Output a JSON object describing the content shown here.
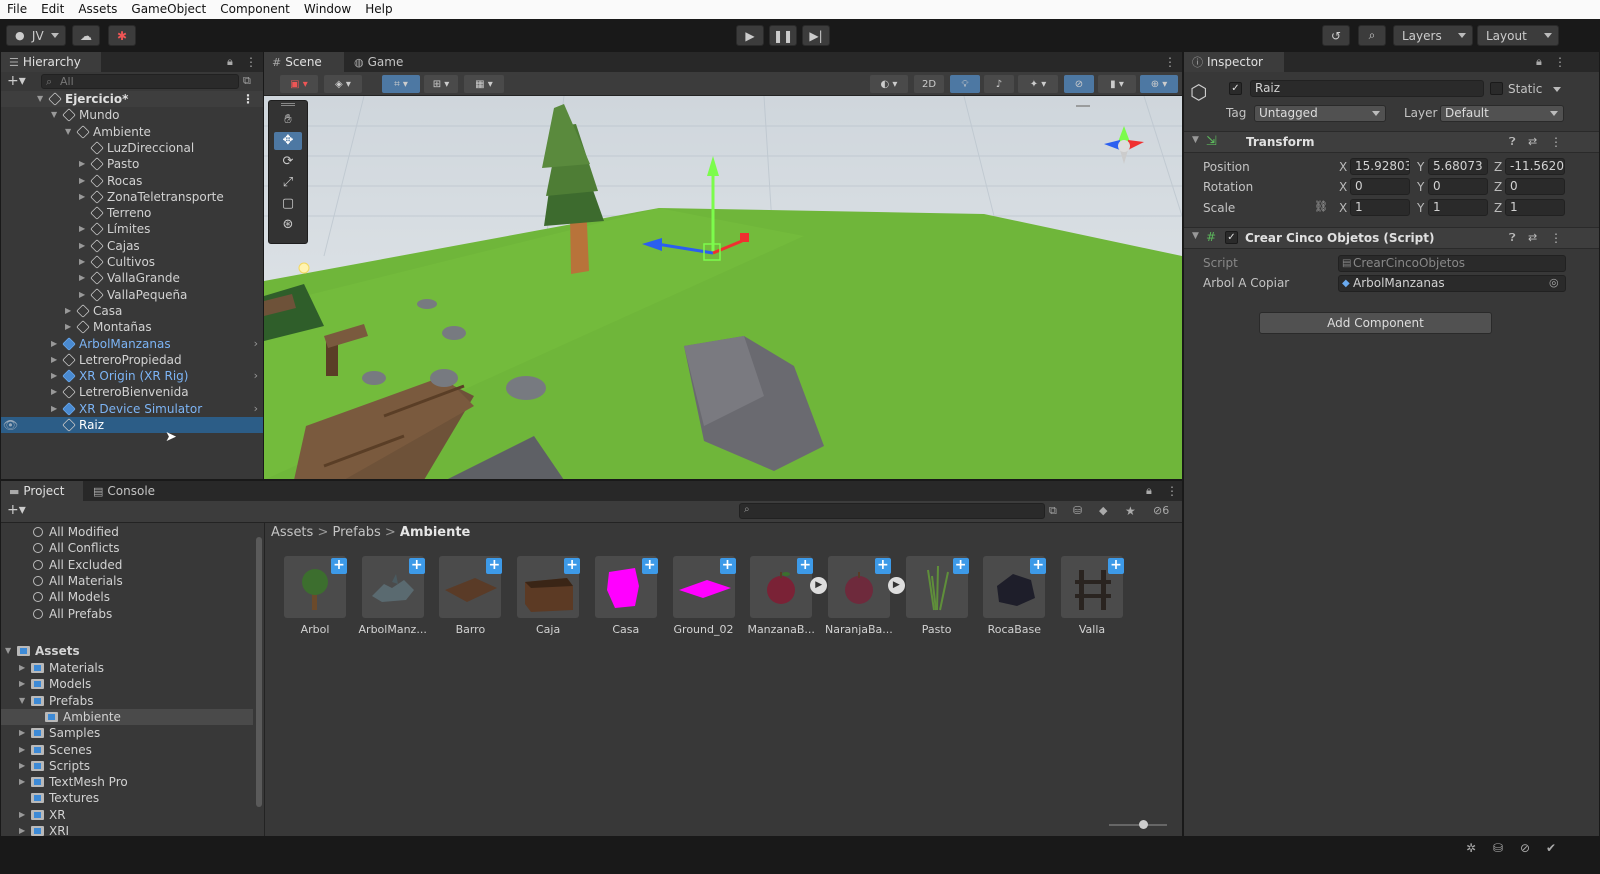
{
  "menu": [
    "File",
    "Edit",
    "Assets",
    "GameObject",
    "Component",
    "Window",
    "Help"
  ],
  "toolbar": {
    "account": "JV",
    "layers": "Layers",
    "layout": "Layout"
  },
  "hierarchy": {
    "tab": "Hierarchy",
    "search_placeholder": "All",
    "rows": [
      {
        "label": "Ejercicio*",
        "indent": 0,
        "kind": "scene",
        "arrow": "down"
      },
      {
        "label": "Mundo",
        "indent": 1,
        "kind": "normal",
        "arrow": "down"
      },
      {
        "label": "Ambiente",
        "indent": 2,
        "kind": "normal",
        "arrow": "down"
      },
      {
        "label": "LuzDireccional",
        "indent": 3,
        "kind": "normal",
        "arrow": ""
      },
      {
        "label": "Pasto",
        "indent": 3,
        "kind": "normal",
        "arrow": "right"
      },
      {
        "label": "Rocas",
        "indent": 3,
        "kind": "normal",
        "arrow": "right"
      },
      {
        "label": "ZonaTeletransporte",
        "indent": 3,
        "kind": "normal",
        "arrow": "right"
      },
      {
        "label": "Terreno",
        "indent": 3,
        "kind": "normal",
        "arrow": ""
      },
      {
        "label": "Límites",
        "indent": 3,
        "kind": "normal",
        "arrow": "right"
      },
      {
        "label": "Cajas",
        "indent": 3,
        "kind": "normal",
        "arrow": "right"
      },
      {
        "label": "Cultivos",
        "indent": 3,
        "kind": "normal",
        "arrow": "right"
      },
      {
        "label": "VallaGrande",
        "indent": 3,
        "kind": "normal",
        "arrow": "right"
      },
      {
        "label": "VallaPequeña",
        "indent": 3,
        "kind": "normal",
        "arrow": "right"
      },
      {
        "label": "Casa",
        "indent": 2,
        "kind": "normal",
        "arrow": "right"
      },
      {
        "label": "Montañas",
        "indent": 2,
        "kind": "normal",
        "arrow": "right"
      },
      {
        "label": "ArbolManzanas",
        "indent": 1,
        "kind": "prefab",
        "arrow": "right",
        "chevron": true
      },
      {
        "label": "LetreroPropiedad",
        "indent": 1,
        "kind": "normal",
        "arrow": "right"
      },
      {
        "label": "XR Origin (XR Rig)",
        "indent": 1,
        "kind": "prefab",
        "arrow": "right",
        "chevron": true
      },
      {
        "label": "LetreroBienvenida",
        "indent": 1,
        "kind": "normal",
        "arrow": "right"
      },
      {
        "label": "XR Device Simulator",
        "indent": 1,
        "kind": "prefab",
        "arrow": "right",
        "chevron": true
      },
      {
        "label": "Raiz",
        "indent": 1,
        "kind": "selected",
        "arrow": ""
      }
    ]
  },
  "scene": {
    "tabs": [
      "Scene",
      "Game"
    ],
    "mode_2d": "2D"
  },
  "inspector": {
    "tab": "Inspector",
    "object_name": "Raiz",
    "static_label": "Static",
    "tag_label": "Tag",
    "tag_value": "Untagged",
    "layer_label": "Layer",
    "layer_value": "Default",
    "transform": {
      "title": "Transform",
      "position_label": "Position",
      "rotation_label": "Rotation",
      "scale_label": "Scale",
      "position": {
        "x": "15.92803",
        "y": "5.68073",
        "z": "-11.5620"
      },
      "rotation": {
        "x": "0",
        "y": "0",
        "z": "0"
      },
      "scale": {
        "x": "1",
        "y": "1",
        "z": "1"
      }
    },
    "axis_labels": {
      "x": "X",
      "y": "Y",
      "z": "Z"
    },
    "script_component": {
      "title": "Crear Cinco Objetos (Script)",
      "script_label": "Script",
      "script_value": "CrearCincoObjetos",
      "field_label": "Arbol A Copiar",
      "field_value": "ArbolManzanas"
    },
    "add_component": "Add Component"
  },
  "project": {
    "tabs": [
      "Project",
      "Console"
    ],
    "hidden_count": "6",
    "favorites": [
      "All Modified",
      "All Conflicts",
      "All Excluded",
      "All Materials",
      "All Models",
      "All Prefabs"
    ],
    "assets_root": "Assets",
    "folders": [
      {
        "label": "Materials",
        "indent": 1,
        "arrow": "right"
      },
      {
        "label": "Models",
        "indent": 1,
        "arrow": "right"
      },
      {
        "label": "Prefabs",
        "indent": 1,
        "arrow": "down"
      },
      {
        "label": "Ambiente",
        "indent": 2,
        "arrow": "",
        "selected": true
      },
      {
        "label": "Samples",
        "indent": 1,
        "arrow": "right"
      },
      {
        "label": "Scenes",
        "indent": 1,
        "arrow": "right"
      },
      {
        "label": "Scripts",
        "indent": 1,
        "arrow": "right"
      },
      {
        "label": "TextMesh Pro",
        "indent": 1,
        "arrow": "right"
      },
      {
        "label": "Textures",
        "indent": 1,
        "arrow": ""
      },
      {
        "label": "XR",
        "indent": 1,
        "arrow": "right"
      },
      {
        "label": "XRI",
        "indent": 1,
        "arrow": "right"
      }
    ],
    "breadcrumb": [
      "Assets",
      "Prefabs",
      "Ambiente"
    ],
    "assets": [
      {
        "label": "Arbol",
        "thumb": "tree",
        "variant": false
      },
      {
        "label": "ArbolManz...",
        "thumb": "dino",
        "variant": false
      },
      {
        "label": "Barro",
        "thumb": "mud",
        "variant": false
      },
      {
        "label": "Caja",
        "thumb": "box",
        "variant": false
      },
      {
        "label": "Casa",
        "thumb": "house",
        "variant": false
      },
      {
        "label": "Ground_02",
        "thumb": "ground",
        "variant": false
      },
      {
        "label": "ManzanaB...",
        "thumb": "apple",
        "variant": true
      },
      {
        "label": "NaranjaBa...",
        "thumb": "orange",
        "variant": true
      },
      {
        "label": "Pasto",
        "thumb": "grass",
        "variant": false
      },
      {
        "label": "RocaBase",
        "thumb": "rock",
        "variant": false
      },
      {
        "label": "Valla",
        "thumb": "fence",
        "variant": false
      }
    ]
  }
}
